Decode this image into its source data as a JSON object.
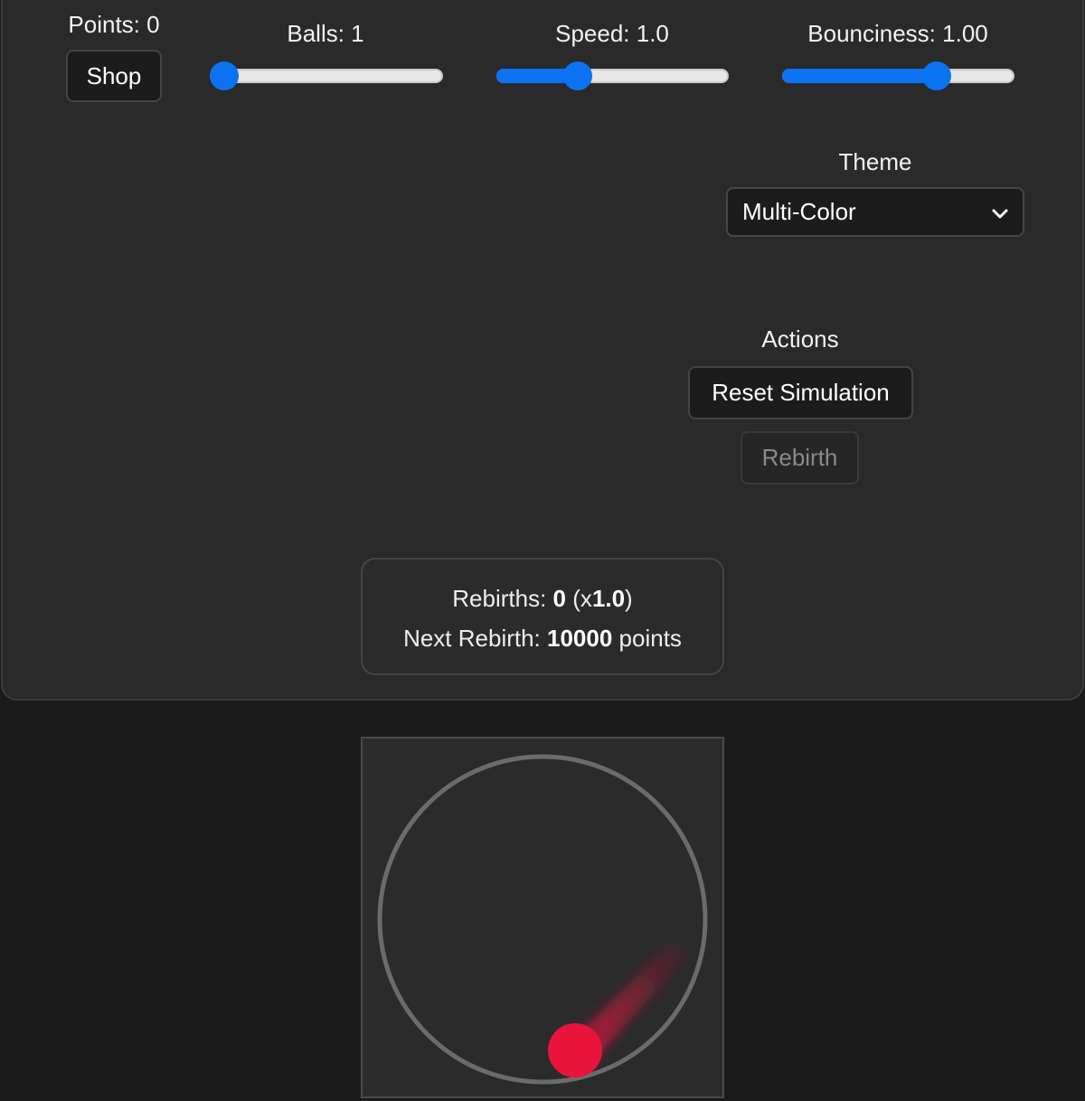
{
  "header": {
    "points_label": "Points: 0",
    "shop_label": "Shop"
  },
  "sliders": [
    {
      "label": "Balls: 1",
      "fraction": 0.0
    },
    {
      "label": "Speed: 1.0",
      "fraction": 0.33
    },
    {
      "label": "Bounciness: 1.00",
      "fraction": 0.69
    }
  ],
  "theme": {
    "label": "Theme",
    "selected": "Multi-Color"
  },
  "actions": {
    "label": "Actions",
    "reset_label": "Reset Simulation",
    "rebirth_label": "Rebirth"
  },
  "stats": {
    "rebirths_prefix": "Rebirths: ",
    "rebirths_count": "0",
    "multiplier_prefix": " (x",
    "multiplier": "1.0",
    "multiplier_suffix": ")",
    "next_prefix": "Next Rebirth: ",
    "next_points": "10000",
    "next_suffix": " points"
  },
  "colors": {
    "accent": "#0b72f2",
    "ball": "#e8143c",
    "ring": "#6b6b6b",
    "panel_bg": "#2a2a2b",
    "page_bg": "#1b1b1b"
  }
}
